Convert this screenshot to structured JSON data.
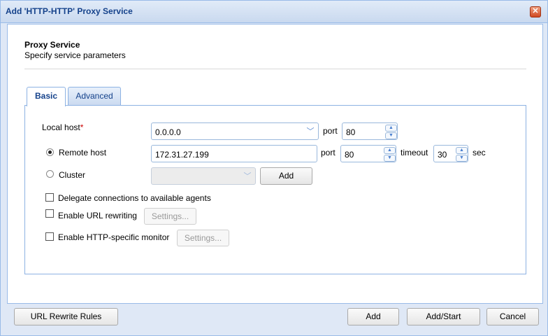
{
  "window": {
    "title": "Add 'HTTP-HTTP' Proxy Service"
  },
  "header": {
    "title": "Proxy Service",
    "subtitle": "Specify service parameters"
  },
  "tabs": [
    {
      "label": "Basic",
      "active": true
    },
    {
      "label": "Advanced",
      "active": false
    }
  ],
  "basic": {
    "local_host_label": "Local host",
    "required_marker": "*",
    "local_host_value": "0.0.0.0",
    "local_port_label": "port",
    "local_port_value": "80",
    "remote_host_label": "Remote host",
    "remote_host_value": "172.31.27.199",
    "remote_port_label": "port",
    "remote_port_value": "80",
    "timeout_label": "timeout",
    "timeout_value": "30",
    "timeout_unit": "sec",
    "cluster_label": "Cluster",
    "cluster_value": "",
    "cluster_add_label": "Add",
    "delegate_label": "Delegate connections to available agents",
    "url_rewriting_label": "Enable URL rewriting",
    "url_rewriting_settings_label": "Settings...",
    "http_monitor_label": "Enable HTTP-specific monitor",
    "http_monitor_settings_label": "Settings..."
  },
  "footer": {
    "url_rewrite_rules_label": "URL Rewrite Rules",
    "add_label": "Add",
    "add_start_label": "Add/Start",
    "cancel_label": "Cancel"
  }
}
